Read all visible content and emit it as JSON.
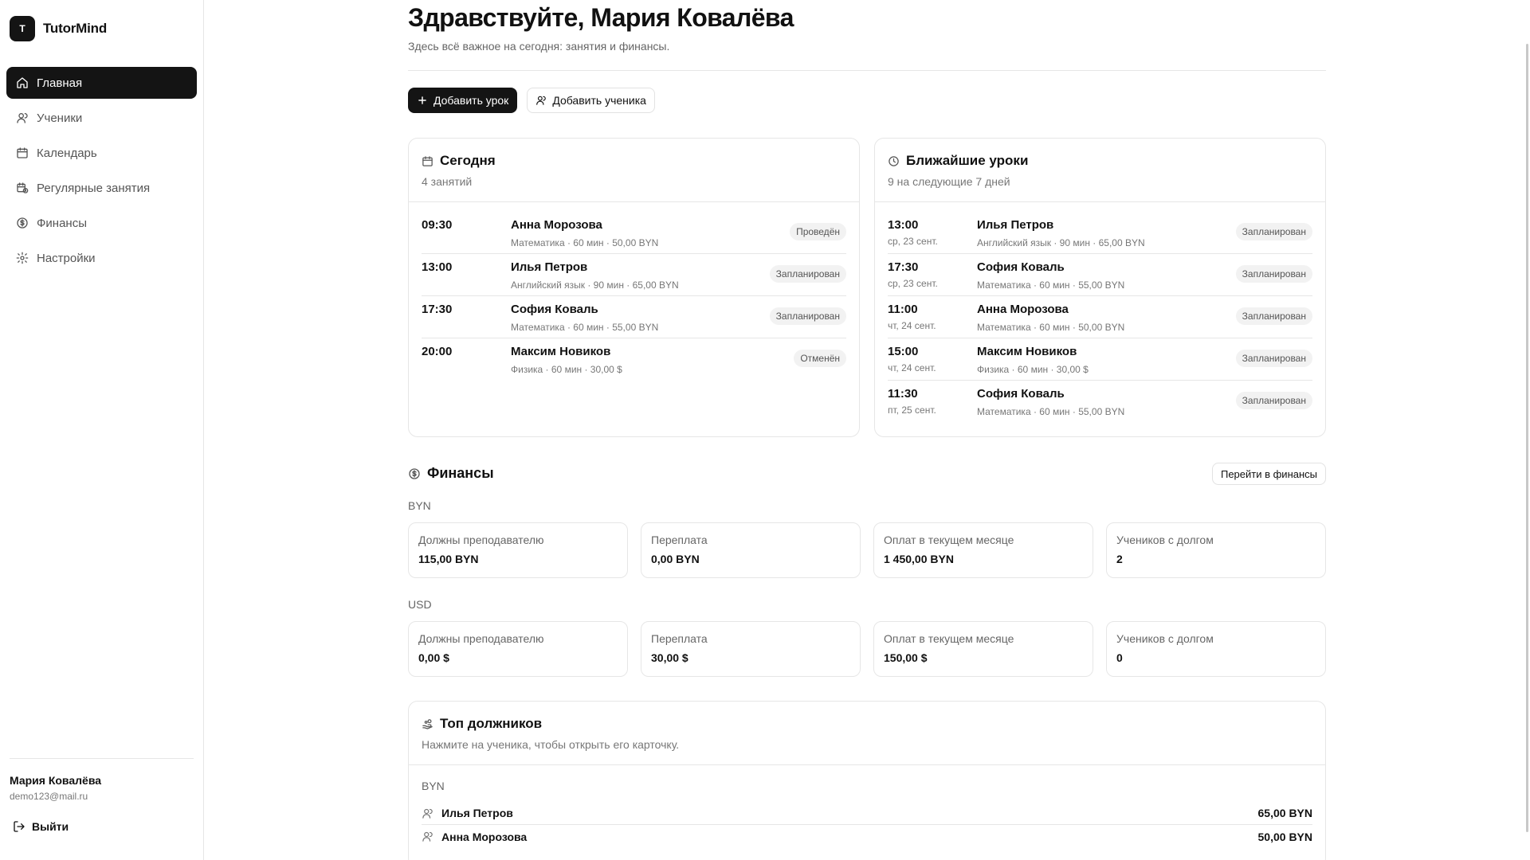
{
  "app": {
    "logo_letter": "T",
    "name": "TutorMind"
  },
  "sidebar": {
    "items": [
      {
        "label": "Главная",
        "icon": "home-icon",
        "active": true
      },
      {
        "label": "Ученики",
        "icon": "user-icon"
      },
      {
        "label": "Календарь",
        "icon": "calendar-icon"
      },
      {
        "label": "Регулярные занятия",
        "icon": "recurring-calendar-icon"
      },
      {
        "label": "Финансы",
        "icon": "dollar-circle-icon"
      },
      {
        "label": "Настройки",
        "icon": "gear-icon"
      }
    ],
    "user": {
      "name": "Мария Ковалёва",
      "email": "demo123@mail.ru"
    },
    "logout_label": "Выйти"
  },
  "header": {
    "title": "Здравствуйте, Мария Ковалёва",
    "subtitle": "Здесь всё важное на сегодня: занятия и финансы."
  },
  "actions": {
    "add_lesson": "Добавить урок",
    "add_student": "Добавить ученика"
  },
  "today": {
    "title": "Сегодня",
    "subtitle": "4 занятий",
    "lessons": [
      {
        "time": "09:30",
        "student": "Анна Морозова",
        "meta": "Математика · 60 мин · 50,00 BYN",
        "status": "Проведён"
      },
      {
        "time": "13:00",
        "student": "Илья Петров",
        "meta": "Английский язык · 90 мин · 65,00 BYN",
        "status": "Запланирован"
      },
      {
        "time": "17:30",
        "student": "София Коваль",
        "meta": "Математика · 60 мин · 55,00 BYN",
        "status": "Запланирован"
      },
      {
        "time": "20:00",
        "student": "Максим Новиков",
        "meta": "Физика · 60 мин · 30,00 $",
        "status": "Отменён"
      }
    ]
  },
  "upcoming": {
    "title": "Ближайшие уроки",
    "subtitle": "9 на следующие 7 дней",
    "lessons": [
      {
        "time": "13:00",
        "date": "ср, 23 сент.",
        "student": "Илья Петров",
        "meta": "Английский язык · 90 мин · 65,00 BYN",
        "status": "Запланирован"
      },
      {
        "time": "17:30",
        "date": "ср, 23 сент.",
        "student": "София Коваль",
        "meta": "Математика · 60 мин · 55,00 BYN",
        "status": "Запланирован"
      },
      {
        "time": "11:00",
        "date": "чт, 24 сент.",
        "student": "Анна Морозова",
        "meta": "Математика · 60 мин · 50,00 BYN",
        "status": "Запланирован"
      },
      {
        "time": "15:00",
        "date": "чт, 24 сент.",
        "student": "Максим Новиков",
        "meta": "Физика · 60 мин · 30,00 $",
        "status": "Запланирован"
      },
      {
        "time": "11:30",
        "date": "пт, 25 сент.",
        "student": "София Коваль",
        "meta": "Математика · 60 мин · 55,00 BYN",
        "status": "Запланирован"
      }
    ]
  },
  "finance": {
    "title": "Финансы",
    "link_label": "Перейти в финансы",
    "currencies": [
      {
        "code": "BYN",
        "stats": [
          {
            "label": "Должны преподавателю",
            "value": "115,00 BYN"
          },
          {
            "label": "Переплата",
            "value": "0,00 BYN"
          },
          {
            "label": "Оплат в текущем месяце",
            "value": "1 450,00 BYN"
          },
          {
            "label": "Учеников с долгом",
            "value": "2"
          }
        ]
      },
      {
        "code": "USD",
        "stats": [
          {
            "label": "Должны преподавателю",
            "value": "0,00 $"
          },
          {
            "label": "Переплата",
            "value": "30,00 $"
          },
          {
            "label": "Оплат в текущем месяце",
            "value": "150,00 $"
          },
          {
            "label": "Учеников с долгом",
            "value": "0"
          }
        ]
      }
    ]
  },
  "debtors": {
    "title": "Топ должников",
    "subtitle": "Нажмите на ученика, чтобы открыть его карточку.",
    "currency": "BYN",
    "items": [
      {
        "name": "Илья Петров",
        "amount": "65,00 BYN"
      },
      {
        "name": "Анна Морозова",
        "amount": "50,00 BYN"
      }
    ]
  }
}
